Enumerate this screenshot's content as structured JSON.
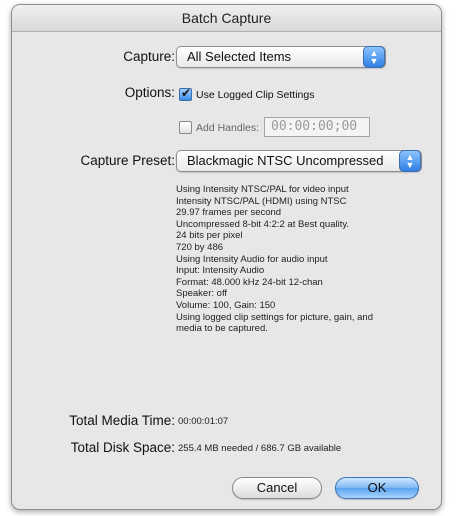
{
  "window": {
    "title": "Batch Capture"
  },
  "capture": {
    "label": "Capture:",
    "value": "All Selected Items"
  },
  "options": {
    "label": "Options:",
    "use_logged_clip_settings": {
      "label": "Use Logged Clip Settings",
      "checked": true
    },
    "add_handles": {
      "label": "Add Handles:",
      "checked": false,
      "value": "00:00:00;00"
    }
  },
  "capture_preset": {
    "label": "Capture Preset:",
    "value": "Blackmagic NTSC Uncompressed"
  },
  "preset_info": [
    "Using Intensity NTSC/PAL for video input",
    "Intensity NTSC/PAL (HDMI) using NTSC",
    "29.97 frames per second",
    "Uncompressed 8-bit 4:2:2 at Best quality.",
    "24 bits per pixel",
    "720 by 486",
    "Using Intensity Audio for audio input",
    "Input: Intensity Audio",
    "Format: 48.000 kHz 24-bit 12-chan",
    "Speaker: off",
    "Volume: 100, Gain: 150",
    "Using logged clip settings for picture, gain, and media to be captured."
  ],
  "totals": {
    "media_time_label": "Total Media Time:",
    "media_time_value": "00:00:01:07",
    "disk_space_label": "Total Disk Space:",
    "disk_space_value": "255.4 MB needed / 686.7 GB available"
  },
  "buttons": {
    "cancel": "Cancel",
    "ok": "OK"
  },
  "colors": {
    "accent": "#3c8ce6",
    "window_bg": "#e7e7e7"
  }
}
